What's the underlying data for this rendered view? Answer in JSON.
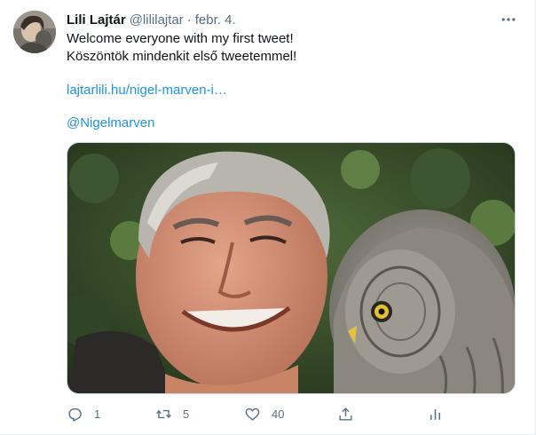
{
  "tweet": {
    "author_name": "Lili Lajtár",
    "handle": "@lililajtar",
    "separator": "·",
    "date": "febr. 4.",
    "lines": [
      "Welcome everyone with my first tweet!",
      "Köszöntök mindenkit első tweetemmel!"
    ],
    "link_url_text": "lajtarlili.hu/nigel-marven-i…",
    "mention": "@Nigelmarven",
    "stats": {
      "replies": "1",
      "retweets": "5",
      "likes": "40"
    }
  },
  "colors": {
    "link": "#1b95e0",
    "secondary_text": "#5b7083",
    "primary_text": "#0f1419"
  },
  "icons": {
    "more": "more-horizontal-icon",
    "reply": "reply-icon",
    "retweet": "retweet-icon",
    "like": "heart-icon",
    "share": "share-icon",
    "analytics": "analytics-icon"
  }
}
